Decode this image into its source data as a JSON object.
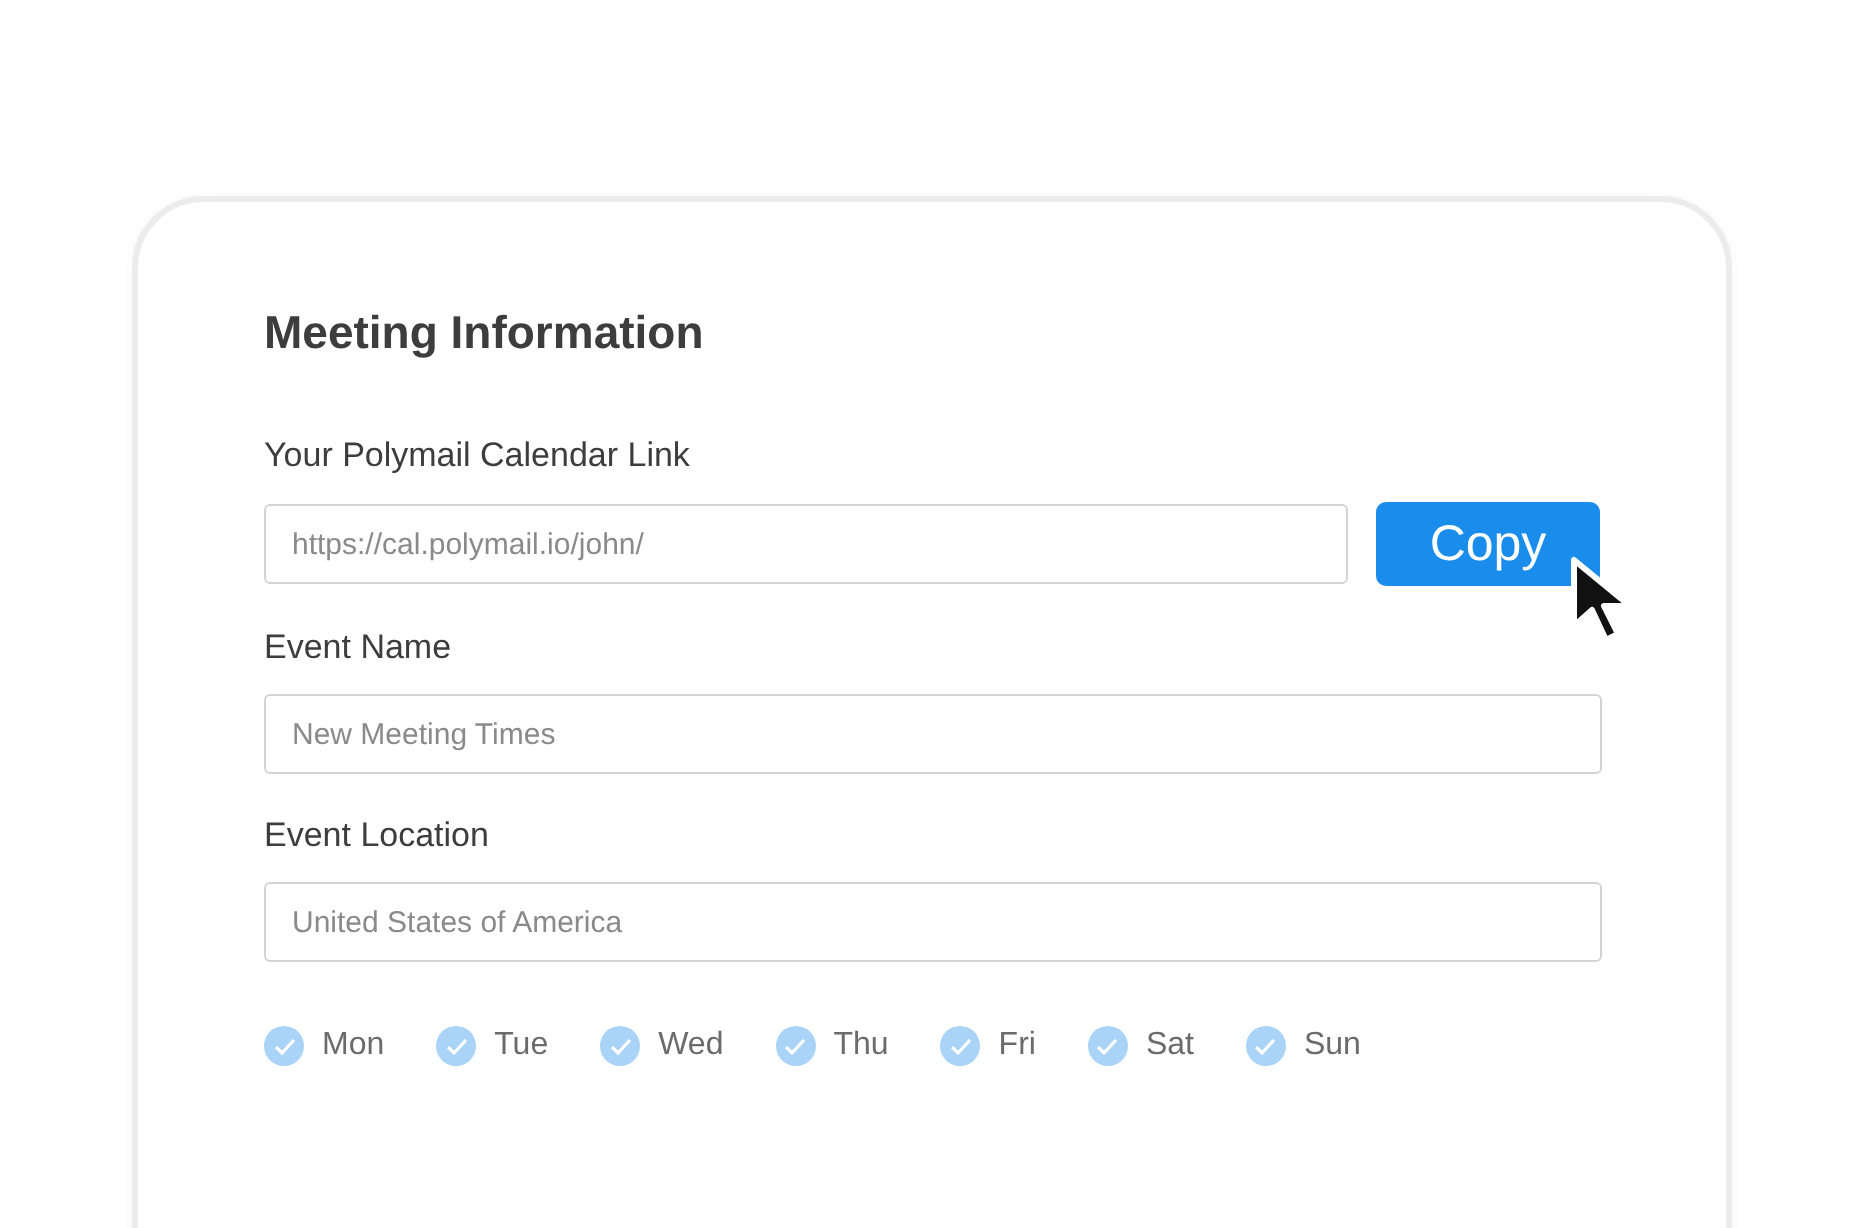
{
  "title": "Meeting Information",
  "link": {
    "label": "Your Polymail Calendar Link",
    "placeholder": "https://cal.polymail.io/john/",
    "button": "Copy"
  },
  "fields": [
    {
      "label": "Event Name",
      "placeholder": "New Meeting Times"
    },
    {
      "label": "Event Location",
      "placeholder": "United States of America"
    }
  ],
  "days": [
    {
      "label": "Mon",
      "checked": true
    },
    {
      "label": "Tue",
      "checked": true
    },
    {
      "label": "Wed",
      "checked": true
    },
    {
      "label": "Thu",
      "checked": true
    },
    {
      "label": "Fri",
      "checked": true
    },
    {
      "label": "Sat",
      "checked": true
    },
    {
      "label": "Sun",
      "checked": true
    }
  ]
}
